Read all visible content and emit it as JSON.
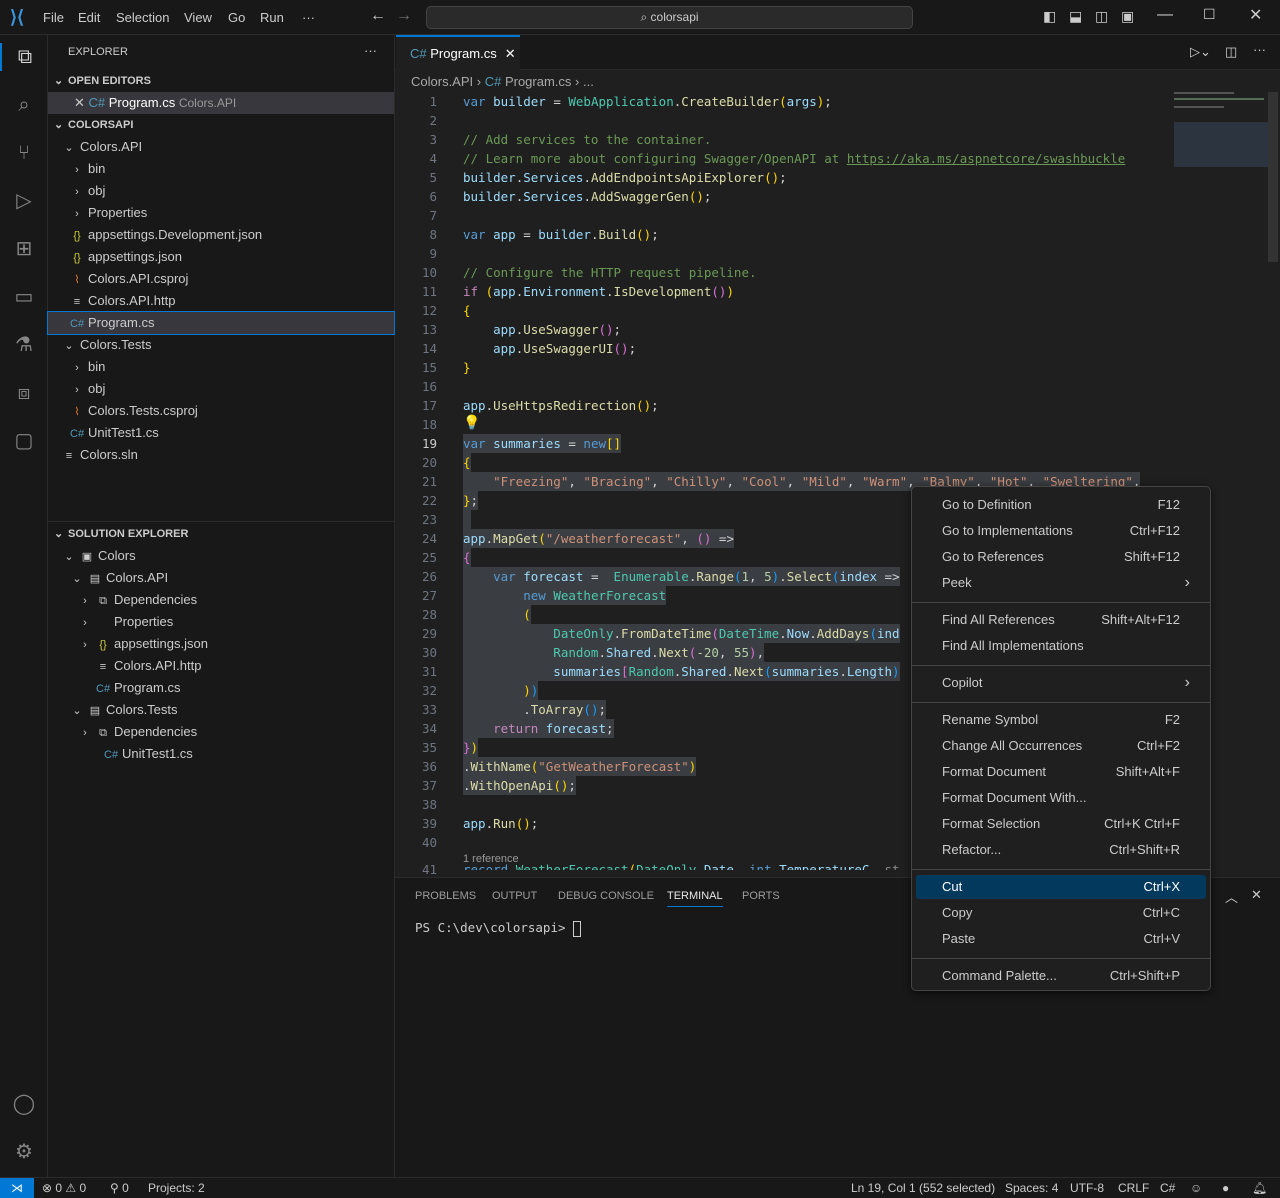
{
  "titlebar": {
    "menus": [
      "File",
      "Edit",
      "Selection",
      "View",
      "Go",
      "Run",
      "···"
    ],
    "search": "colorsapi"
  },
  "sidebar": {
    "title": "EXPLORER",
    "more": "···",
    "open_editors": {
      "header": "OPEN EDITORS",
      "items": [
        {
          "name": "Program.cs",
          "desc": "Colors.API"
        }
      ]
    },
    "folder": {
      "header": "COLORSAPI",
      "items": [
        {
          "label": "Colors.API",
          "icon": "chevron-down",
          "indent": 1
        },
        {
          "label": "bin",
          "icon": "chevron-right",
          "indent": 2
        },
        {
          "label": "obj",
          "icon": "chevron-right",
          "indent": 2
        },
        {
          "label": "Properties",
          "icon": "chevron-right",
          "indent": 2
        },
        {
          "label": "appsettings.Development.json",
          "icon": "json",
          "indent": 2
        },
        {
          "label": "appsettings.json",
          "icon": "json",
          "indent": 2
        },
        {
          "label": "Colors.API.csproj",
          "icon": "rss",
          "indent": 2
        },
        {
          "label": "Colors.API.http",
          "icon": "lines",
          "indent": 2
        },
        {
          "label": "Program.cs",
          "icon": "csharp",
          "indent": 2,
          "selected": true
        },
        {
          "label": "Colors.Tests",
          "icon": "chevron-down",
          "indent": 1
        },
        {
          "label": "bin",
          "icon": "chevron-right",
          "indent": 2
        },
        {
          "label": "obj",
          "icon": "chevron-right",
          "indent": 2
        },
        {
          "label": "Colors.Tests.csproj",
          "icon": "rss",
          "indent": 2
        },
        {
          "label": "UnitTest1.cs",
          "icon": "csharp",
          "indent": 2
        },
        {
          "label": "Colors.sln",
          "icon": "lines",
          "indent": 1
        }
      ]
    },
    "solution": {
      "header": "SOLUTION EXPLORER",
      "items": [
        {
          "label": "Colors",
          "icon": "solution",
          "indent": 1,
          "chev": "v"
        },
        {
          "label": "Colors.API",
          "icon": "project",
          "indent": 2,
          "chev": "v"
        },
        {
          "label": "Dependencies",
          "icon": "deps",
          "indent": 3,
          "chev": ">"
        },
        {
          "label": "Properties",
          "icon": "",
          "indent": 3,
          "chev": ">"
        },
        {
          "label": "appsettings.json",
          "icon": "json",
          "indent": 3,
          "chev": ">"
        },
        {
          "label": "Colors.API.http",
          "icon": "lines",
          "indent": 3,
          "chev": ""
        },
        {
          "label": "Program.cs",
          "icon": "csharp",
          "indent": 3,
          "chev": ""
        },
        {
          "label": "Colors.Tests",
          "icon": "project",
          "indent": 2,
          "chev": "v"
        },
        {
          "label": "Dependencies",
          "icon": "deps",
          "indent": 3,
          "chev": ">"
        },
        {
          "label": "UnitTest1.cs",
          "icon": "csharp",
          "indent": 4,
          "chev": ""
        }
      ]
    }
  },
  "editor": {
    "tab": "Program.cs",
    "breadcrumb": [
      "Colors.API",
      "Program.cs",
      "..."
    ],
    "current_line": 19,
    "codelens": "1 reference",
    "lines": [
      [
        [
          "var ",
          "kw"
        ],
        [
          "builder",
          "vr"
        ],
        [
          " = ",
          ""
        ],
        [
          "WebApplication",
          "ty"
        ],
        [
          ".",
          ""
        ],
        [
          "CreateBuilder",
          "fn"
        ],
        [
          "(",
          "b1"
        ],
        [
          "args",
          "vr"
        ],
        [
          ")",
          "b1"
        ],
        [
          ";",
          ""
        ]
      ],
      [],
      [
        [
          "// Add services to the container.",
          "cm"
        ]
      ],
      [
        [
          "// Learn more about configuring Swagger/OpenAPI at ",
          "cm"
        ],
        [
          "https://aka.ms/aspnetcore/swashbuckle",
          "lk"
        ]
      ],
      [
        [
          "builder",
          "vr"
        ],
        [
          ".",
          ""
        ],
        [
          "Services",
          "vr"
        ],
        [
          ".",
          ""
        ],
        [
          "AddEndpointsApiExplorer",
          "fn"
        ],
        [
          "()",
          "b1"
        ],
        [
          ";",
          ""
        ]
      ],
      [
        [
          "builder",
          "vr"
        ],
        [
          ".",
          ""
        ],
        [
          "Services",
          "vr"
        ],
        [
          ".",
          ""
        ],
        [
          "AddSwaggerGen",
          "fn"
        ],
        [
          "()",
          "b1"
        ],
        [
          ";",
          ""
        ]
      ],
      [],
      [
        [
          "var ",
          "kw"
        ],
        [
          "app",
          "vr"
        ],
        [
          " = ",
          ""
        ],
        [
          "builder",
          "vr"
        ],
        [
          ".",
          ""
        ],
        [
          "Build",
          "fn"
        ],
        [
          "()",
          "b1"
        ],
        [
          ";",
          ""
        ]
      ],
      [],
      [
        [
          "// Configure the HTTP request pipeline.",
          "cm"
        ]
      ],
      [
        [
          "if ",
          "ct"
        ],
        [
          "(",
          "b1"
        ],
        [
          "app",
          "vr"
        ],
        [
          ".",
          ""
        ],
        [
          "Environment",
          "vr"
        ],
        [
          ".",
          ""
        ],
        [
          "IsDevelopment",
          "fn"
        ],
        [
          "()",
          "b2"
        ],
        [
          ")",
          "b1"
        ]
      ],
      [
        [
          "{",
          "b1"
        ]
      ],
      [
        [
          "    app",
          "vr"
        ],
        [
          ".",
          ""
        ],
        [
          "UseSwagger",
          "fn"
        ],
        [
          "()",
          "b2"
        ],
        [
          ";",
          ""
        ]
      ],
      [
        [
          "    app",
          "vr"
        ],
        [
          ".",
          ""
        ],
        [
          "UseSwaggerUI",
          "fn"
        ],
        [
          "()",
          "b2"
        ],
        [
          ";",
          ""
        ]
      ],
      [
        [
          "}",
          "b1"
        ]
      ],
      [],
      [
        [
          "app",
          "vr"
        ],
        [
          ".",
          ""
        ],
        [
          "UseHttpsRedirection",
          "fn"
        ],
        [
          "()",
          "b1"
        ],
        [
          ";",
          ""
        ]
      ],
      [],
      [
        [
          "var ",
          "kw"
        ],
        [
          "summaries",
          "vr"
        ],
        [
          " = ",
          ""
        ],
        [
          "new",
          "kw"
        ],
        [
          "[]",
          "b1"
        ]
      ],
      [
        [
          "{",
          "b1"
        ]
      ],
      [
        [
          "    \"Freezing\"",
          "st"
        ],
        [
          ", ",
          ""
        ],
        [
          "\"Bracing\"",
          "st"
        ],
        [
          ", ",
          ""
        ],
        [
          "\"Chilly\"",
          "st"
        ],
        [
          ", ",
          ""
        ],
        [
          "\"Cool\"",
          "st"
        ],
        [
          ", ",
          ""
        ],
        [
          "\"Mild\"",
          "st"
        ],
        [
          ", ",
          ""
        ],
        [
          "\"Warm\"",
          "st"
        ],
        [
          ", ",
          ""
        ],
        [
          "\"Balmy\"",
          "st"
        ],
        [
          ", ",
          ""
        ],
        [
          "\"Hot\"",
          "st"
        ],
        [
          ", ",
          ""
        ],
        [
          "\"Sweltering\"",
          "st"
        ],
        [
          ",",
          ""
        ]
      ],
      [
        [
          "}",
          "b1"
        ],
        [
          ";",
          ""
        ]
      ],
      [],
      [
        [
          "app",
          "vr"
        ],
        [
          ".",
          ""
        ],
        [
          "MapGet",
          "fn"
        ],
        [
          "(",
          "b1"
        ],
        [
          "\"/weatherforecast\"",
          "st"
        ],
        [
          ", ",
          ""
        ],
        [
          "()",
          "b2"
        ],
        [
          " =>",
          ""
        ]
      ],
      [
        [
          "{",
          "b2"
        ]
      ],
      [
        [
          "    var ",
          "kw"
        ],
        [
          "forecast",
          "vr"
        ],
        [
          " =  ",
          ""
        ],
        [
          "Enumerable",
          "ty"
        ],
        [
          ".",
          ""
        ],
        [
          "Range",
          "fn"
        ],
        [
          "(",
          "b3"
        ],
        [
          "1",
          "nm"
        ],
        [
          ", ",
          ""
        ],
        [
          "5",
          "nm"
        ],
        [
          ")",
          "b3"
        ],
        [
          ".",
          ""
        ],
        [
          "Select",
          "fn"
        ],
        [
          "(",
          "b3"
        ],
        [
          "index",
          "vr"
        ],
        [
          " =>",
          ""
        ]
      ],
      [
        [
          "        new ",
          "kw"
        ],
        [
          "WeatherForecast",
          "ty"
        ]
      ],
      [
        [
          "        (",
          "b1"
        ]
      ],
      [
        [
          "            DateOnly",
          "ty"
        ],
        [
          ".",
          ""
        ],
        [
          "FromDateTime",
          "fn"
        ],
        [
          "(",
          "b2"
        ],
        [
          "DateTime",
          "ty"
        ],
        [
          ".",
          ""
        ],
        [
          "Now",
          "vr"
        ],
        [
          ".",
          ""
        ],
        [
          "AddDays",
          "fn"
        ],
        [
          "(",
          "b3"
        ],
        [
          "ind",
          "vr"
        ]
      ],
      [
        [
          "            Random",
          "ty"
        ],
        [
          ".",
          ""
        ],
        [
          "Shared",
          "vr"
        ],
        [
          ".",
          ""
        ],
        [
          "Next",
          "fn"
        ],
        [
          "(",
          "b2"
        ],
        [
          "-20",
          "nm"
        ],
        [
          ", ",
          ""
        ],
        [
          "55",
          "nm"
        ],
        [
          ")",
          "b2"
        ],
        [
          ",",
          ""
        ]
      ],
      [
        [
          "            summaries",
          "vr"
        ],
        [
          "[",
          "b2"
        ],
        [
          "Random",
          "ty"
        ],
        [
          ".",
          ""
        ],
        [
          "Shared",
          "vr"
        ],
        [
          ".",
          ""
        ],
        [
          "Next",
          "fn"
        ],
        [
          "(",
          "b3"
        ],
        [
          "summaries",
          "vr"
        ],
        [
          ".",
          ""
        ],
        [
          "Length",
          "vr"
        ],
        [
          ")",
          "b3"
        ]
      ],
      [
        [
          "        )",
          "b1"
        ],
        [
          ")",
          "b3"
        ]
      ],
      [
        [
          "        .",
          ""
        ],
        [
          "ToArray",
          "fn"
        ],
        [
          "()",
          "b3"
        ],
        [
          ";",
          ""
        ]
      ],
      [
        [
          "    return ",
          "ct"
        ],
        [
          "forecast",
          "vr"
        ],
        [
          ";",
          ""
        ]
      ],
      [
        [
          "}",
          "b2"
        ],
        [
          ")",
          "b1"
        ]
      ],
      [
        [
          ".",
          ""
        ],
        [
          "WithName",
          "fn"
        ],
        [
          "(",
          "b1"
        ],
        [
          "\"GetWeatherForecast\"",
          "st"
        ],
        [
          ")",
          "b1"
        ]
      ],
      [
        [
          ".",
          ""
        ],
        [
          "WithOpenApi",
          "fn"
        ],
        [
          "()",
          "b1"
        ],
        [
          ";",
          ""
        ]
      ],
      [],
      [
        [
          "app",
          "vr"
        ],
        [
          ".",
          ""
        ],
        [
          "Run",
          "fn"
        ],
        [
          "()",
          "b1"
        ],
        [
          ";",
          ""
        ]
      ],
      [],
      [
        [
          "record ",
          "kw"
        ],
        [
          "WeatherForecast",
          "ty"
        ],
        [
          "(",
          "b1"
        ],
        [
          "DateOnly ",
          "ty"
        ],
        [
          "Date",
          "vr"
        ],
        [
          ", ",
          ""
        ],
        [
          "int ",
          "kw"
        ],
        [
          "TemperatureC",
          "vr"
        ],
        [
          ", st",
          ""
        ]
      ]
    ]
  },
  "panel": {
    "tabs": [
      "PROBLEMS",
      "OUTPUT",
      "DEBUG CONSOLE",
      "TERMINAL",
      "PORTS"
    ],
    "active": "TERMINAL",
    "prompt": "PS C:\\dev\\colorsapi> "
  },
  "context_menu": {
    "groups": [
      [
        {
          "label": "Go to Definition",
          "key": "F12"
        },
        {
          "label": "Go to Implementations",
          "key": "Ctrl+F12"
        },
        {
          "label": "Go to References",
          "key": "Shift+F12"
        },
        {
          "label": "Peek",
          "key": "›"
        }
      ],
      [
        {
          "label": "Find All References",
          "key": "Shift+Alt+F12"
        },
        {
          "label": "Find All Implementations",
          "key": ""
        }
      ],
      [
        {
          "label": "Copilot",
          "key": "›"
        }
      ],
      [
        {
          "label": "Rename Symbol",
          "key": "F2"
        },
        {
          "label": "Change All Occurrences",
          "key": "Ctrl+F2"
        },
        {
          "label": "Format Document",
          "key": "Shift+Alt+F"
        },
        {
          "label": "Format Document With...",
          "key": ""
        },
        {
          "label": "Format Selection",
          "key": "Ctrl+K Ctrl+F"
        },
        {
          "label": "Refactor...",
          "key": "Ctrl+Shift+R"
        }
      ],
      [
        {
          "label": "Cut",
          "key": "Ctrl+X",
          "active": true
        },
        {
          "label": "Copy",
          "key": "Ctrl+C"
        },
        {
          "label": "Paste",
          "key": "Ctrl+V"
        }
      ],
      [
        {
          "label": "Command Palette...",
          "key": "Ctrl+Shift+P"
        }
      ]
    ]
  },
  "status": {
    "errors": "0",
    "warnings": "0",
    "ports": "0",
    "projects": "Projects: 2",
    "position": "Ln 19, Col 1 (552 selected)",
    "spaces": "Spaces: 4",
    "encoding": "UTF-8",
    "eol": "CRLF",
    "language": "C#"
  },
  "colors": {
    "accent": "#0078d4",
    "menu_active": "#04395e",
    "selection": "#3a3d41"
  }
}
